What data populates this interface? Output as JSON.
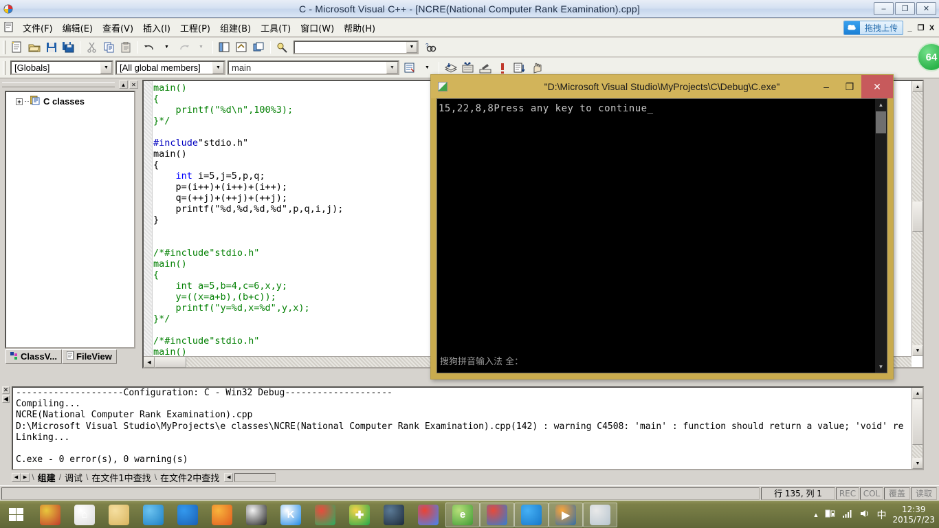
{
  "window": {
    "title": "C - Microsoft Visual C++ - [NCRE(National Computer Rank Examination).cpp]",
    "minimize": "–",
    "restore": "❐",
    "close": "✕"
  },
  "menubar": {
    "items": [
      {
        "label": "文件(F)",
        "name": "menu-file"
      },
      {
        "label": "编辑(E)",
        "name": "menu-edit"
      },
      {
        "label": "查看(V)",
        "name": "menu-view"
      },
      {
        "label": "插入(I)",
        "name": "menu-insert"
      },
      {
        "label": "工程(P)",
        "name": "menu-project"
      },
      {
        "label": "组建(B)",
        "name": "menu-build"
      },
      {
        "label": "工具(T)",
        "name": "menu-tools"
      },
      {
        "label": "窗口(W)",
        "name": "menu-window"
      },
      {
        "label": "帮助(H)",
        "name": "menu-help"
      }
    ],
    "baidu_upload": "拖拽上传",
    "mdi_minimize": "_",
    "mdi_restore": "❐",
    "mdi_close": "X"
  },
  "toolbar": {
    "search_value": "",
    "arrow": "▼"
  },
  "wizardbar": {
    "globals": "[Globals]",
    "members": "[All global members]",
    "function": "main",
    "arrow": "▼"
  },
  "workspace": {
    "tree_root": "C classes",
    "expand": "+",
    "tabs": [
      {
        "label": "ClassV...",
        "name": "tab-classview"
      },
      {
        "label": "FileView",
        "name": "tab-fileview"
      }
    ],
    "collapse_btn": "▲",
    "close_btn": "✕"
  },
  "editor": {
    "lines": [
      [
        {
          "t": "main()",
          "c": "g"
        }
      ],
      [
        {
          "t": "{",
          "c": "g"
        }
      ],
      [
        {
          "t": "    printf(\"%d\\n\",100%3);",
          "c": "g"
        }
      ],
      [
        {
          "t": "}*/",
          "c": "g"
        }
      ],
      [
        {
          "t": "",
          "c": "n"
        }
      ],
      [
        {
          "t": "#include",
          "c": "b"
        },
        {
          "t": "\"stdio.h\"",
          "c": "n"
        }
      ],
      [
        {
          "t": "main()",
          "c": "n"
        }
      ],
      [
        {
          "t": "{",
          "c": "n"
        }
      ],
      [
        {
          "t": "    ",
          "c": "n"
        },
        {
          "t": "int",
          "c": "k"
        },
        {
          "t": " i=5,j=5,p,q;",
          "c": "n"
        }
      ],
      [
        {
          "t": "    p=(i++)+(i++)+(i++);",
          "c": "n"
        }
      ],
      [
        {
          "t": "    q=(++j)+(++j)+(++j);",
          "c": "n"
        }
      ],
      [
        {
          "t": "    printf(\"%d,%d,%d,%d\",p,q,i,j);",
          "c": "n"
        }
      ],
      [
        {
          "t": "}",
          "c": "n"
        }
      ],
      [
        {
          "t": "",
          "c": "n"
        }
      ],
      [
        {
          "t": "",
          "c": "n"
        }
      ],
      [
        {
          "t": "/*#include\"stdio.h\"",
          "c": "g"
        }
      ],
      [
        {
          "t": "main()",
          "c": "g"
        }
      ],
      [
        {
          "t": "{",
          "c": "g"
        }
      ],
      [
        {
          "t": "    int a=5,b=4,c=6,x,y;",
          "c": "g"
        }
      ],
      [
        {
          "t": "    y=((x=a+b),(b+c));",
          "c": "g"
        }
      ],
      [
        {
          "t": "    printf(\"y=%d,x=%d\",y,x);",
          "c": "g"
        }
      ],
      [
        {
          "t": "}*/",
          "c": "g"
        }
      ],
      [
        {
          "t": "",
          "c": "n"
        }
      ],
      [
        {
          "t": "/*#include\"stdio.h\"",
          "c": "g"
        }
      ],
      [
        {
          "t": "main()",
          "c": "g"
        }
      ]
    ]
  },
  "output": {
    "text": "--------------------Configuration: C - Win32 Debug--------------------\nCompiling...\nNCRE(National Computer Rank Examination).cpp\nD:\\Microsoft Visual Studio\\MyProjects\\e classes\\NCRE(National Computer Rank Examination).cpp(142) : warning C4508: 'main' : function should return a value; 'void' re\nLinking...\n\nC.exe - 0 error(s), 0 warning(s)",
    "tabs": [
      {
        "label": "组建",
        "active": true
      },
      {
        "label": "调试",
        "active": false
      },
      {
        "label": "在文件1中查找",
        "active": false
      },
      {
        "label": "在文件2中查找",
        "active": false
      }
    ],
    "close_btn": "✕",
    "up_btn": "◀",
    "left_arrow": "◀",
    "right_arrow": "▶"
  },
  "statusbar": {
    "position": "行 135, 列 1",
    "cells": [
      "REC",
      "COL",
      "覆盖",
      "读取"
    ]
  },
  "console": {
    "title": "\"D:\\Microsoft Visual Studio\\MyProjects\\C\\Debug\\C.exe\"",
    "output": "15,22,8,8Press any key to continue_",
    "ime_status": "搜狗拼音输入法 全：",
    "minimize": "–",
    "maximize": "❐",
    "close": "✕",
    "scroll_up": "▲",
    "scroll_down": "▼"
  },
  "badge": {
    "label": "64"
  },
  "taskbar": {
    "start": "start-button",
    "items": [
      {
        "name": "taskbar-sogou",
        "glyph": "",
        "color1": "#e8c73c",
        "color2": "#c0392b",
        "active": false
      },
      {
        "name": "taskbar-home",
        "glyph": "⌂",
        "color1": "#ffffff",
        "color2": "#dddddd",
        "active": false
      },
      {
        "name": "taskbar-explorer",
        "glyph": "",
        "color1": "#f5dfa0",
        "color2": "#d9b45e",
        "active": false
      },
      {
        "name": "taskbar-qqbrowser",
        "glyph": "",
        "color1": "#6cc3f0",
        "color2": "#1d7fc4",
        "active": false
      },
      {
        "name": "taskbar-thunder",
        "glyph": "",
        "color1": "#3399ee",
        "color2": "#1a5fb4",
        "active": false
      },
      {
        "name": "taskbar-firefox",
        "glyph": "",
        "color1": "#f8b43c",
        "color2": "#e05a1e",
        "active": false
      },
      {
        "name": "taskbar-qq",
        "glyph": "",
        "color1": "#f2f2f2",
        "color2": "#222222",
        "active": false
      },
      {
        "name": "taskbar-kingsoft",
        "glyph": "K",
        "color1": "#ffffff",
        "color2": "#1e88e5",
        "active": false
      },
      {
        "name": "taskbar-360",
        "glyph": "",
        "color1": "#e74c3c",
        "color2": "#27ae60",
        "active": false
      },
      {
        "name": "taskbar-security",
        "glyph": "✚",
        "color1": "#f5d44a",
        "color2": "#21a84a",
        "active": false
      },
      {
        "name": "taskbar-steam",
        "glyph": "",
        "color1": "#5b7a96",
        "color2": "#1b2838",
        "active": false
      },
      {
        "name": "taskbar-chrome",
        "glyph": "",
        "color1": "#ea4335",
        "color2": "#4285f4",
        "active": false
      },
      {
        "name": "taskbar-ie-360se",
        "glyph": "e",
        "color1": "#b7e07a",
        "color2": "#3f9b35",
        "active": true
      },
      {
        "name": "taskbar-visual-cpp",
        "glyph": "",
        "color1": "#e64a3b",
        "color2": "#2f7fd4",
        "active": true
      },
      {
        "name": "taskbar-baidu-cloud",
        "glyph": "",
        "color1": "#45b0f5",
        "color2": "#1677c9",
        "active": true
      },
      {
        "name": "taskbar-media-player",
        "glyph": "▶",
        "color1": "#f7a53b",
        "color2": "#2f6ca8",
        "active": true
      },
      {
        "name": "taskbar-window-active",
        "glyph": "",
        "color1": "#e9e9e9",
        "color2": "#b7c5cf",
        "active": true
      }
    ],
    "tray": {
      "show_hidden": "▲",
      "battery": "battery-icon",
      "network": "network-icon",
      "volume": "volume-icon",
      "ime": "中",
      "time": "12:39",
      "date": "2015/7/23"
    }
  }
}
